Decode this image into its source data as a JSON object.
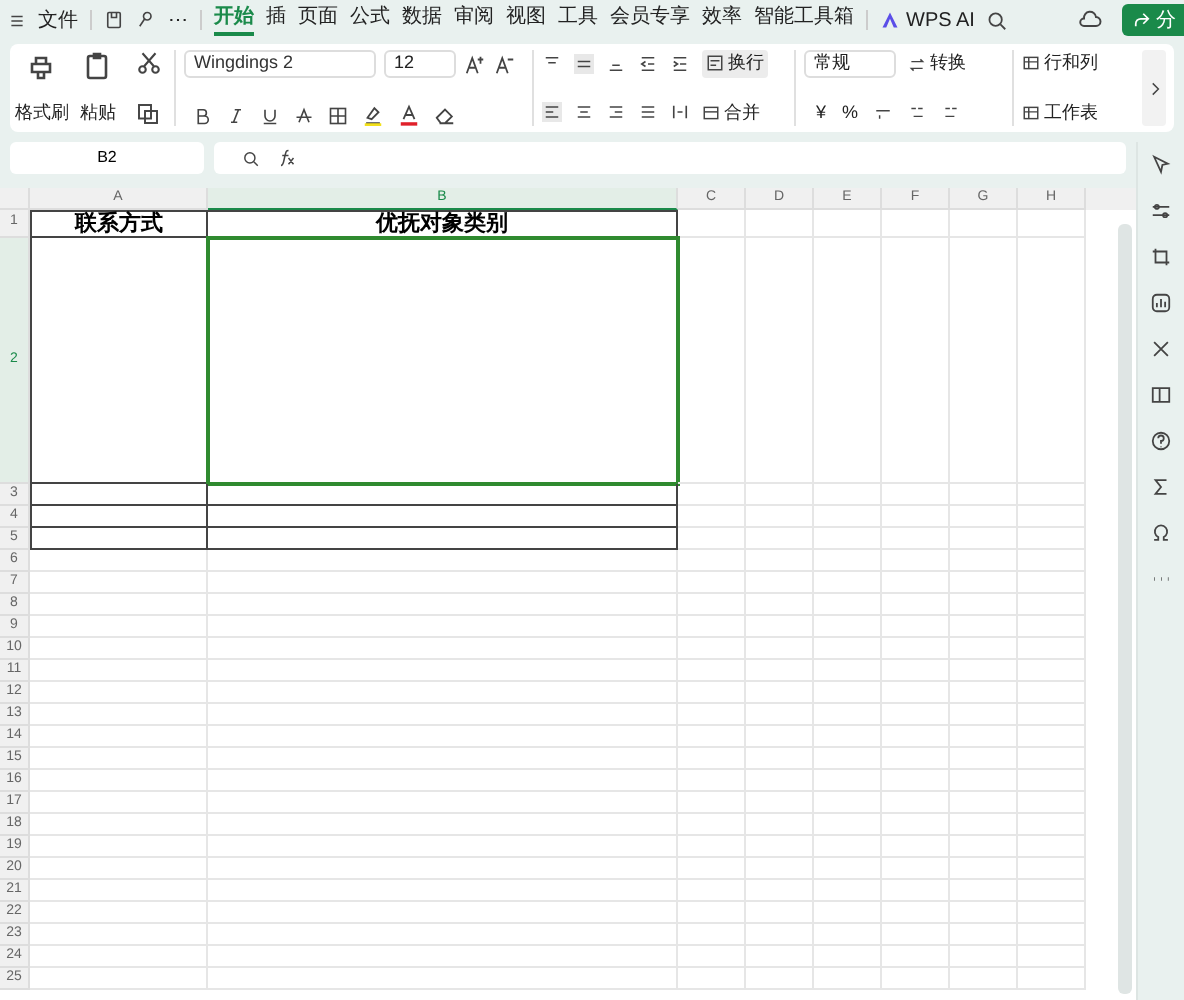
{
  "menu": {
    "file": "文件",
    "more": "⋯"
  },
  "tabs": [
    {
      "label": "开始",
      "selected": true
    },
    {
      "label": "插",
      "selected": false
    },
    {
      "label": "页面",
      "selected": false
    },
    {
      "label": "公式",
      "selected": false
    },
    {
      "label": "数据",
      "selected": false
    },
    {
      "label": "审阅",
      "selected": false
    },
    {
      "label": "视图",
      "selected": false
    },
    {
      "label": "工具",
      "selected": false
    },
    {
      "label": "会员专享",
      "selected": false
    },
    {
      "label": "效率",
      "selected": false
    },
    {
      "label": "智能工具箱",
      "selected": false
    }
  ],
  "ai": "WPS AI",
  "share": "分",
  "ribbon": {
    "format_painter": "格式刷",
    "paste": "粘贴",
    "font": "Wingdings 2",
    "size": "12",
    "wrap": "换行",
    "merge": "合并",
    "number_format": "常规",
    "convert": "转换",
    "rows_cols": "行和列",
    "worksheet": "工作表",
    "currency": "¥",
    "percent": "%"
  },
  "name_box": "B2",
  "sheet": {
    "columns": [
      {
        "label": "A",
        "selected": false
      },
      {
        "label": "B",
        "selected": true
      },
      {
        "label": "C",
        "selected": false
      },
      {
        "label": "D",
        "selected": false
      },
      {
        "label": "E",
        "selected": false
      },
      {
        "label": "F",
        "selected": false
      },
      {
        "label": "G",
        "selected": false
      },
      {
        "label": "H",
        "selected": false
      }
    ],
    "rows": [
      {
        "number": "1",
        "selected": false,
        "bordered": true,
        "cells": [
          "联系方式",
          "优抚对象类别"
        ]
      },
      {
        "number": "2",
        "selected": true,
        "bordered": true,
        "cells": []
      },
      {
        "number": "3",
        "selected": false,
        "bordered": true,
        "cells": []
      },
      {
        "number": "4",
        "selected": false,
        "bordered": true,
        "cells": []
      },
      {
        "number": "5",
        "selected": false,
        "bordered": true,
        "cells": []
      },
      {
        "number": "6",
        "selected": false,
        "bordered": false,
        "cells": []
      },
      {
        "number": "7",
        "selected": false,
        "bordered": false,
        "cells": []
      },
      {
        "number": "8",
        "selected": false,
        "bordered": false,
        "cells": []
      },
      {
        "number": "9",
        "selected": false,
        "bordered": false,
        "cells": []
      },
      {
        "number": "10",
        "selected": false,
        "bordered": false,
        "cells": []
      },
      {
        "number": "11",
        "selected": false,
        "bordered": false,
        "cells": []
      },
      {
        "number": "12",
        "selected": false,
        "bordered": false,
        "cells": []
      },
      {
        "number": "13",
        "selected": false,
        "bordered": false,
        "cells": []
      },
      {
        "number": "14",
        "selected": false,
        "bordered": false,
        "cells": []
      },
      {
        "number": "15",
        "selected": false,
        "bordered": false,
        "cells": []
      },
      {
        "number": "16",
        "selected": false,
        "bordered": false,
        "cells": []
      },
      {
        "number": "17",
        "selected": false,
        "bordered": false,
        "cells": []
      },
      {
        "number": "18",
        "selected": false,
        "bordered": false,
        "cells": []
      },
      {
        "number": "19",
        "selected": false,
        "bordered": false,
        "cells": []
      },
      {
        "number": "20",
        "selected": false,
        "bordered": false,
        "cells": []
      },
      {
        "number": "21",
        "selected": false,
        "bordered": false,
        "cells": []
      },
      {
        "number": "22",
        "selected": false,
        "bordered": false,
        "cells": []
      },
      {
        "number": "23",
        "selected": false,
        "bordered": false,
        "cells": []
      },
      {
        "number": "24",
        "selected": false,
        "bordered": false,
        "cells": []
      },
      {
        "number": "25",
        "selected": false,
        "bordered": false,
        "cells": []
      }
    ]
  }
}
